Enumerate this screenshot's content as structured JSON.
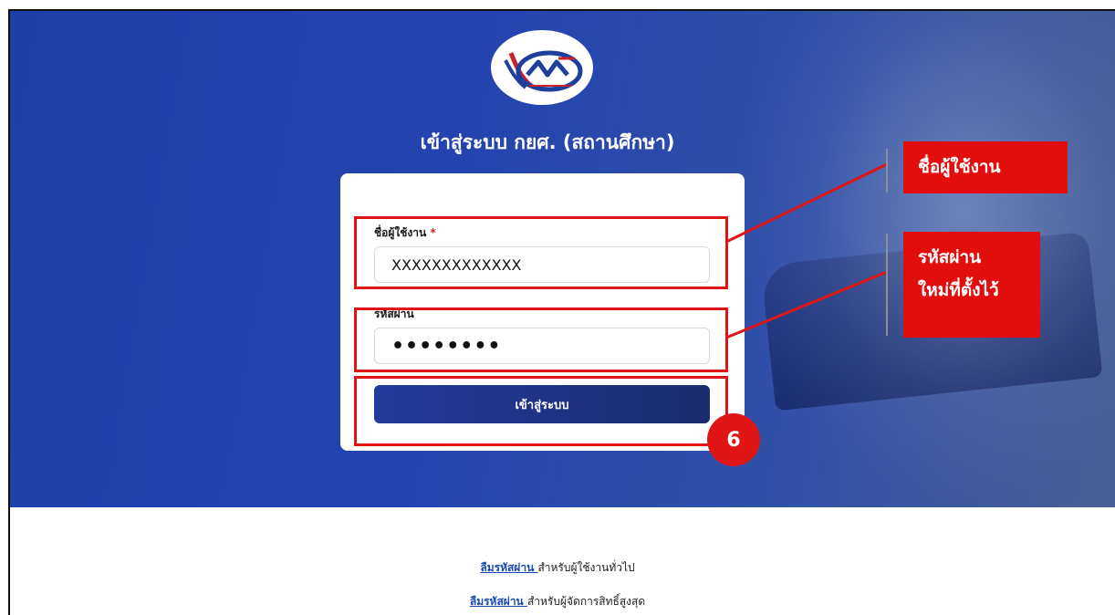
{
  "header": {
    "title": "เข้าสู่ระบบ กยศ. (สถานศึกษา)"
  },
  "form": {
    "username_label": "ชื่อผู้ใช้งาน",
    "required_mark": "*",
    "username_value": "XXXXXXXXXXXXX",
    "password_label": "รหัสผ่าน",
    "password_value": "••••••••",
    "submit_label": "เข้าสู่ระบบ"
  },
  "annotations": {
    "callout_username": "ชื่อผู้ใช้งาน",
    "callout_password_line1": "รหัสผ่าน",
    "callout_password_line2": "ใหม่ที่ตั้งไว้",
    "step_number": "6",
    "highlight_color": "#e01616"
  },
  "footer": {
    "forgot_general_link": "ลืมรหัสผ่าน ",
    "forgot_general_text": "สำหรับผู้ใช้งานทั่วไป",
    "forgot_admin_link": "ลืมรหัสผ่าน ",
    "forgot_admin_text": "สำหรับผู้จัดการสิทธิ์สูงสุด"
  },
  "colors": {
    "hero_bg": "#2344b0",
    "button_bg": "#233b9a",
    "link": "#1a4ab0"
  }
}
